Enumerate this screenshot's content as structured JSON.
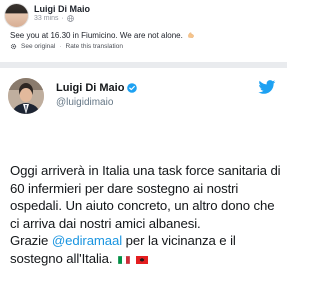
{
  "post": {
    "author": "Luigi Di Maio",
    "time": "33 mins",
    "caption_text": "See you at 16.30 in Fiumicino. We are not alone.",
    "see_original": "See original",
    "separator": "·",
    "rate_translation": "Rate this translation"
  },
  "tweet": {
    "name": "Luigi Di Maio",
    "handle": "@luigidimaio",
    "paragraph1": "Oggi arriverà in Italia una task force sanitaria di 60 infermieri per dare sostegno ai nostri ospedali. Un aiuto concreto, un altro dono che ci arriva dai nostri amici albanesi.",
    "thanks_prefix": "Grazie ",
    "mention": "@ediramaal",
    "thanks_suffix": " per la vicinanza e il sostegno all'Italia.",
    "flags": [
      "flag-italy-icon",
      "flag-albania-icon"
    ]
  },
  "colors": {
    "link": "#1b95e0",
    "twitter_blue": "#1da1f2",
    "albania_red": "#e41e20"
  }
}
